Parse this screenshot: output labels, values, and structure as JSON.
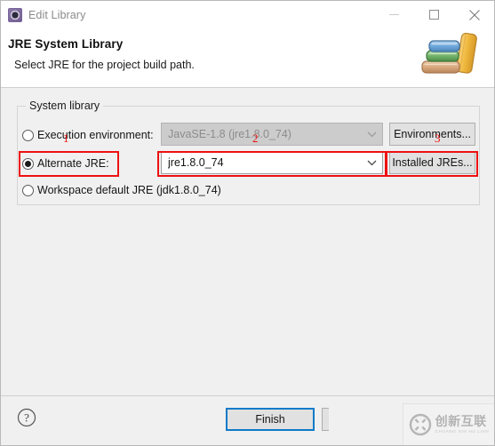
{
  "window": {
    "title": "Edit Library",
    "app_icon": "gear-icon",
    "controls": {
      "minimize": "minimize-icon",
      "maximize": "maximize-icon",
      "close": "close-icon"
    }
  },
  "header": {
    "title": "JRE System Library",
    "subtitle": "Select JRE for the project build path.",
    "banner_icon": "books-icon"
  },
  "system_library": {
    "group_label": "System library",
    "options": [
      {
        "label": "Execution environment:",
        "selected": false,
        "combo_value": "JavaSE-1.8 (jre1.8.0_74)",
        "combo_disabled": true,
        "button_label": "Environments..."
      },
      {
        "label": "Alternate JRE:",
        "selected": true,
        "combo_value": "jre1.8.0_74",
        "combo_disabled": false,
        "button_label": "Installed JREs..."
      },
      {
        "label": "Workspace default JRE (jdk1.8.0_74)",
        "selected": false
      }
    ]
  },
  "annotations": [
    {
      "number": "1"
    },
    {
      "number": "2"
    },
    {
      "number": "3"
    }
  ],
  "footer": {
    "help_label": "?",
    "finish_label": "Finish"
  },
  "watermark": {
    "chinese": "创新互联",
    "pinyin": "CHUANG XIN HU LIAN",
    "logo": "circled-x-logo"
  },
  "colors": {
    "annotation_red": "#ee1111",
    "focus_blue": "#0b7ac8",
    "dialog_bg": "#f0f0f0"
  }
}
